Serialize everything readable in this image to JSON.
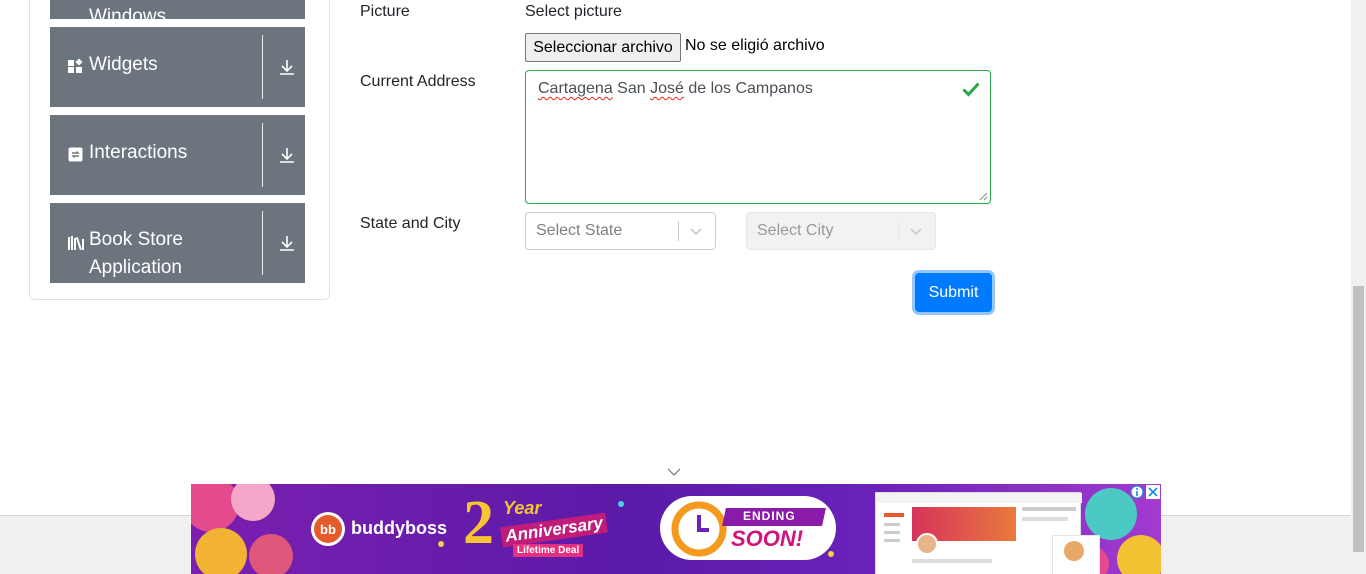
{
  "sidebar": {
    "groups": [
      {
        "label": "Windows",
        "icon": "window-icon"
      },
      {
        "label": "Widgets",
        "icon": "widgets-icon"
      },
      {
        "label": "Interactions",
        "icon": "interactions-icon"
      },
      {
        "label_line1": "Book Store",
        "label_line2": "Application",
        "icon": "book-store-icon"
      }
    ]
  },
  "form": {
    "picture": {
      "label": "Picture",
      "hint": "Select picture",
      "button": "Seleccionar archivo",
      "status": "No se eligió archivo"
    },
    "address": {
      "label": "Current Address",
      "word1": "Cartagena",
      "mid": " San ",
      "word2": "José",
      "rest": " de los Campanos"
    },
    "state_city": {
      "label": "State and City",
      "state_placeholder": "Select State",
      "city_placeholder": "Select City"
    },
    "submit": "Submit"
  },
  "ad": {
    "brand": "buddyboss",
    "anniv_number": "2",
    "anniv_year": "Year",
    "anniv_word": "Anniversary",
    "anniv_deal": "Lifetime Deal",
    "ending_line1": "ENDING",
    "ending_line2": "SOON!"
  },
  "colors": {
    "sidebar_bg": "#6c757d",
    "valid_green": "#28a745",
    "submit_blue": "#007bff",
    "ad_purple": "#5b1aa8"
  }
}
